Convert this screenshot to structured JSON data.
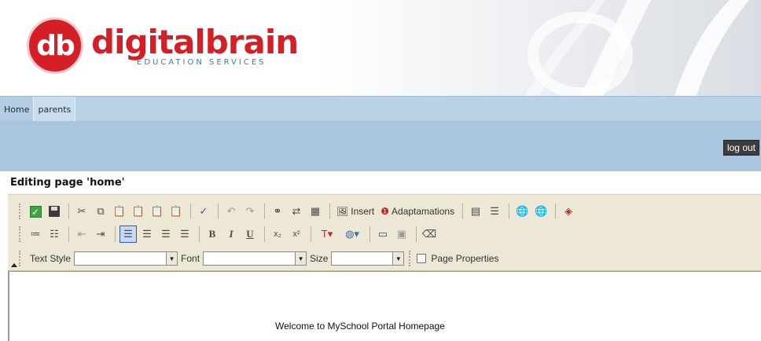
{
  "header": {
    "logo_initials": "db",
    "logo_name": "digitalbrain",
    "logo_tagline": "EDUCATION SERVICES"
  },
  "nav": {
    "tabs": [
      {
        "label": "Home",
        "active": true
      },
      {
        "label": "parents",
        "active": false
      }
    ],
    "logout_label": "log out"
  },
  "editor": {
    "title": "Editing page 'home'",
    "toolbar": {
      "insert_label": "Insert",
      "adaptamations_label": "Adaptamations",
      "bold_label": "B",
      "italic_label": "I",
      "underline_label": "U",
      "text_style_label": "Text Style",
      "text_style_value": "",
      "font_label": "Font",
      "font_value": "",
      "size_label": "Size",
      "size_value": "",
      "page_properties_label": "Page Properties"
    },
    "content": "Welcome to MySchool Portal Homepage"
  },
  "colors": {
    "brand_red": "#d51f26",
    "brand_blue": "#2f7db4",
    "nav_blue": "#b9d2e6",
    "band_blue": "#a9c6de",
    "toolbar_bg": "#ede8d6"
  }
}
